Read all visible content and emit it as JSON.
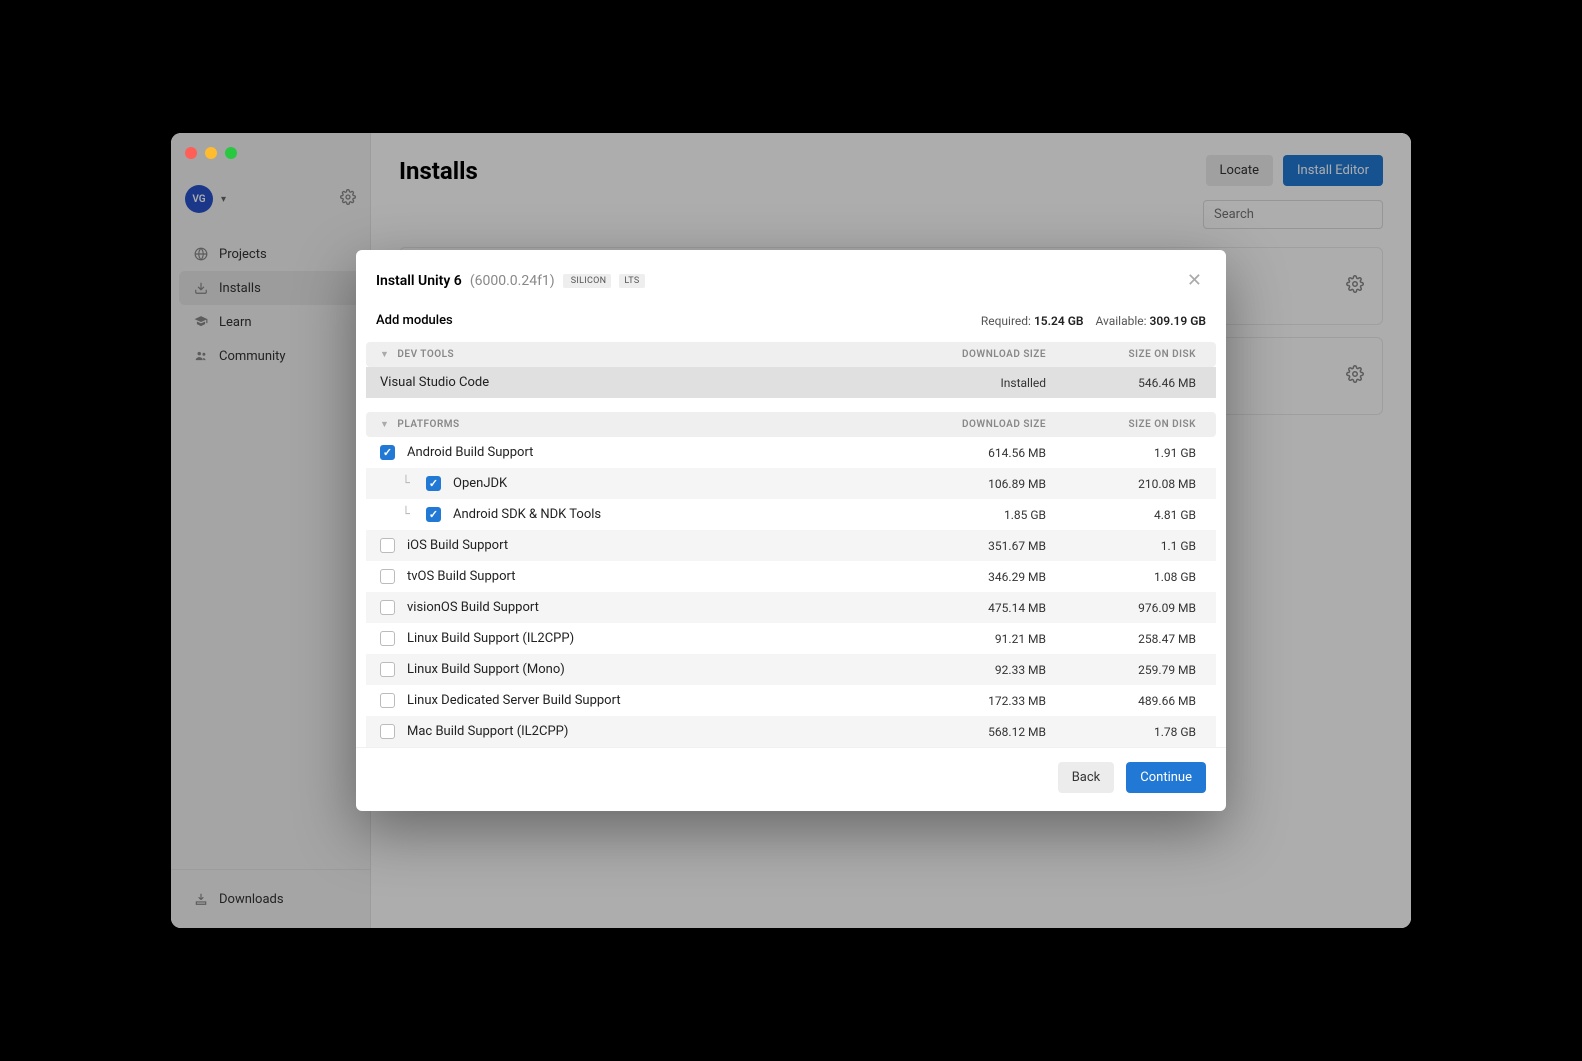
{
  "user": {
    "initials": "VG"
  },
  "sidebar": {
    "items": [
      {
        "label": "Projects",
        "icon": "globe-icon"
      },
      {
        "label": "Installs",
        "icon": "download-icon"
      },
      {
        "label": "Learn",
        "icon": "grad-cap-icon"
      },
      {
        "label": "Community",
        "icon": "people-icon"
      }
    ],
    "footer": {
      "label": "Downloads",
      "icon": "tray-icon"
    }
  },
  "header": {
    "title": "Installs",
    "locate_label": "Locate",
    "install_label": "Install Editor",
    "search_placeholder": "Search"
  },
  "modal": {
    "title": "Install Unity 6",
    "version": "(6000.0.24f1)",
    "chip_silicon": "SILICON",
    "chip_lts": "LTS",
    "subheader": "Add modules",
    "required_label": "Required:",
    "required_value": "15.24 GB",
    "available_label": "Available:",
    "available_value": "309.19 GB",
    "sections": {
      "devtools": {
        "label": "DEV TOOLS",
        "col_dl": "DOWNLOAD SIZE",
        "col_disk": "SIZE ON DISK",
        "rows": [
          {
            "name": "Visual Studio Code",
            "installed": true,
            "installed_label": "Installed",
            "disk": "546.46 MB"
          }
        ]
      },
      "platforms": {
        "label": "PLATFORMS",
        "col_dl": "DOWNLOAD SIZE",
        "col_disk": "SIZE ON DISK",
        "rows": [
          {
            "name": "Android Build Support",
            "checked": true,
            "dl": "614.56 MB",
            "disk": "1.91 GB"
          },
          {
            "name": "OpenJDK",
            "checked": true,
            "child": true,
            "dl": "106.89 MB",
            "disk": "210.08 MB"
          },
          {
            "name": "Android SDK & NDK Tools",
            "checked": true,
            "child": true,
            "dl": "1.85 GB",
            "disk": "4.81 GB"
          },
          {
            "name": "iOS Build Support",
            "checked": false,
            "dl": "351.67 MB",
            "disk": "1.1 GB"
          },
          {
            "name": "tvOS Build Support",
            "checked": false,
            "dl": "346.29 MB",
            "disk": "1.08 GB"
          },
          {
            "name": "visionOS Build Support",
            "checked": false,
            "dl": "475.14 MB",
            "disk": "976.09 MB"
          },
          {
            "name": "Linux Build Support (IL2CPP)",
            "checked": false,
            "dl": "91.21 MB",
            "disk": "258.47 MB"
          },
          {
            "name": "Linux Build Support (Mono)",
            "checked": false,
            "dl": "92.33 MB",
            "disk": "259.79 MB"
          },
          {
            "name": "Linux Dedicated Server Build Support",
            "checked": false,
            "dl": "172.33 MB",
            "disk": "489.66 MB"
          },
          {
            "name": "Mac Build Support (IL2CPP)",
            "checked": false,
            "dl": "568.12 MB",
            "disk": "1.78 GB"
          }
        ]
      }
    },
    "back_label": "Back",
    "continue_label": "Continue"
  }
}
